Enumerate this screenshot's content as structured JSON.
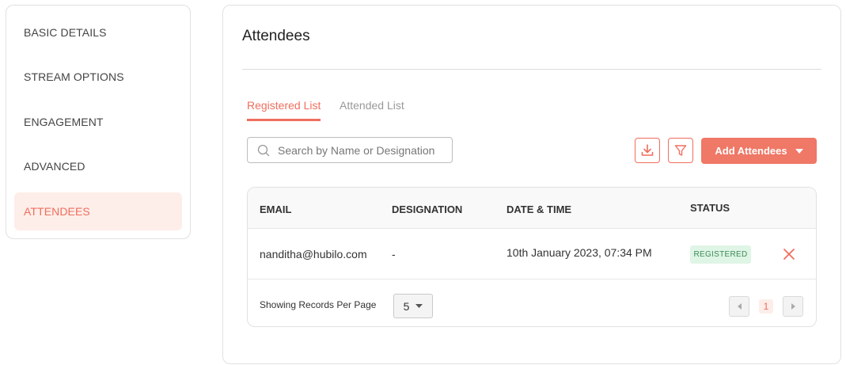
{
  "sidebar": {
    "items": [
      {
        "label": "BASIC DETAILS"
      },
      {
        "label": "STREAM OPTIONS"
      },
      {
        "label": "ENGAGEMENT"
      },
      {
        "label": "ADVANCED"
      },
      {
        "label": "ATTENDEES",
        "active": true
      }
    ]
  },
  "panel": {
    "title": "Attendees",
    "tabs": [
      {
        "label": "Registered List",
        "active": true
      },
      {
        "label": "Attended List",
        "active": false
      }
    ],
    "search": {
      "placeholder": "Search by Name or Designation",
      "value": ""
    },
    "toolbar": {
      "download_icon": "download-icon",
      "filter_icon": "filter-icon",
      "add_label": "Add Attendees"
    }
  },
  "table": {
    "headers": [
      "EMAIL",
      "DESIGNATION",
      "DATE & TIME",
      "STATUS"
    ],
    "rows": [
      {
        "email": "nanditha@hubilo.com",
        "designation": "-",
        "datetime": "10th January 2023, 07:34 PM",
        "status": "REGISTERED"
      }
    ],
    "footer": {
      "per_page_label": "Showing Records Per Page",
      "per_page_value": "5",
      "current_page": "1"
    }
  },
  "colors": {
    "accent": "#ef6e5e",
    "accent_light": "#fdeee9",
    "status_bg": "#dff5e6",
    "status_text": "#3e8a56"
  }
}
